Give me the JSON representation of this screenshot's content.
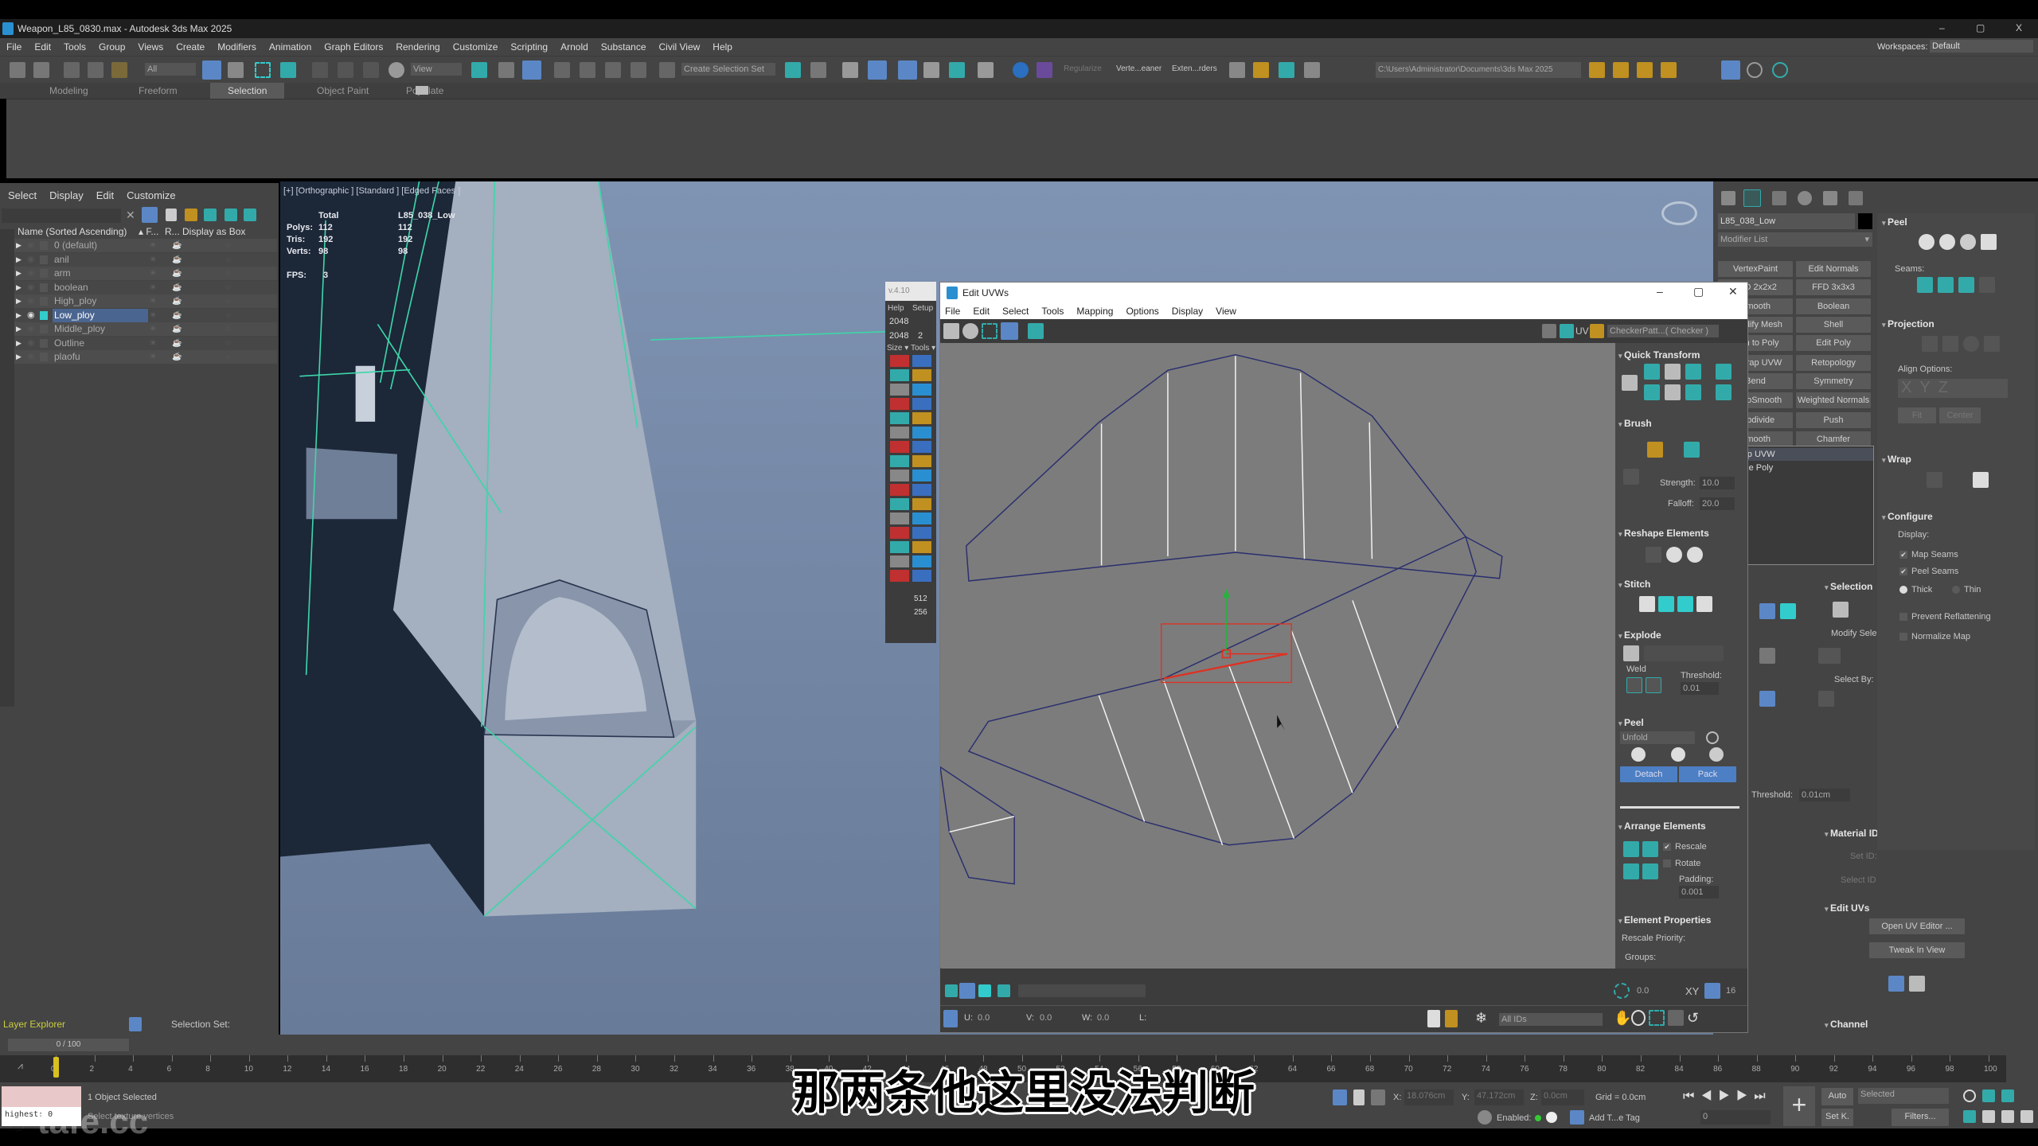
{
  "window": {
    "title": "Weapon_L85_0830.max - Autodesk 3ds Max 2025",
    "min": "–",
    "max": "▢",
    "close": "X",
    "workspaces_label": "Workspaces:",
    "workspace": "Default"
  },
  "menu": [
    "File",
    "Edit",
    "Tools",
    "Group",
    "Views",
    "Create",
    "Modifiers",
    "Animation",
    "Graph Editors",
    "Rendering",
    "Customize",
    "Scripting",
    "Arnold",
    "Substance",
    "Civil View",
    "Help"
  ],
  "toolbar": {
    "filter": "All",
    "ref_coord": "View",
    "selection_set": "Create Selection Set",
    "regularize": "Regularize",
    "vertex_cleaner": "Verte...eaner",
    "extenders": "Exten...rders",
    "project_path": "C:\\Users\\Administrator\\Documents\\3ds Max 2025"
  },
  "ribbon_tabs": [
    "Modeling",
    "Freeform",
    "Selection",
    "Object Paint",
    "Populate"
  ],
  "ribbon_active": "Selection",
  "scene_explorer": {
    "menu": [
      "Select",
      "Display",
      "Edit",
      "Customize"
    ],
    "columns": [
      "Name (Sorted Ascending)",
      "▴ F...",
      "R...",
      "Display as Box"
    ],
    "layers": [
      "0 (default)",
      "anil",
      "arm",
      "boolean",
      "High_ploy",
      "Low_ploy",
      "Middle_ploy",
      "Outline",
      "plaofu"
    ],
    "active": "Low_ploy",
    "footer": "Layer Explorer",
    "selection_set_label": "Selection Set:"
  },
  "viewport": {
    "label": "[+] [Orthographic ] [Standard ] [Edged Faces ]",
    "stats": {
      "col_total": "Total",
      "col_object": "L85_038_Low",
      "polys_label": "Polys:",
      "polys": "112",
      "polys_obj": "112",
      "tris_label": "Tris:",
      "tris": "192",
      "tris_obj": "192",
      "verts_label": "Verts:",
      "verts": "98",
      "verts_obj": "98",
      "fps_label": "FPS:",
      "fps": "3"
    }
  },
  "plugin_strip": {
    "version": "v.4.10",
    "help": "Help",
    "setup": "Setup",
    "w": "2048",
    "h": "2048",
    "n": "2",
    "size": "Size ▾",
    "tools": "Tools ▾",
    "v512": "512",
    "v256": "256"
  },
  "uvw": {
    "title": "Edit UVWs",
    "menu": [
      "File",
      "Edit",
      "Select",
      "Tools",
      "Mapping",
      "Options",
      "Display",
      "View"
    ],
    "texture": "CheckerPatt...( Checker )",
    "uv_label": "UV",
    "quick_transform": "Quick Transform",
    "brush": "Brush",
    "strength_label": "Strength:",
    "strength": "10.0",
    "falloff_label": "Falloff:",
    "falloff": "20.0",
    "reshape": "Reshape Elements",
    "stitch": "Stitch",
    "explode": "Explode",
    "weld": "Weld",
    "threshold_label": "Threshold:",
    "threshold": "0.01",
    "peel": "Peel",
    "unfold": "Unfold",
    "detach": "Detach",
    "pack": "Pack",
    "arrange": "Arrange Elements",
    "rescale": "Rescale",
    "rotate": "Rotate",
    "padding_label": "Padding:",
    "padding": "0.001",
    "element_props": "Element Properties",
    "rescale_priority": "Rescale Priority:",
    "groups": "Groups:",
    "bottom": {
      "spin1": "0.0",
      "spin2": "16",
      "xy": "XY",
      "u_label": "U:",
      "u": "0.0",
      "v_label": "V:",
      "v": "0.0",
      "w_label": "W:",
      "w": "0.0",
      "l_label": "L:",
      "ids": "All IDs"
    },
    "selected_color": "#e03020",
    "edge_color": "#2a2f6e"
  },
  "command_panel": {
    "object_name": "L85_038_Low",
    "modifier_list": "Modifier List",
    "buttons": [
      [
        "MeshSmooth",
        "VertexPaint",
        "Edit Normals"
      ],
      [
        "FFD 2x2x2",
        "FFD 3x3x3"
      ],
      [
        "Smooth",
        "Boolean"
      ],
      [
        "Quadify Mesh",
        "Shell"
      ],
      [
        "Turn to Poly",
        "Edit Poly"
      ],
      [
        "Unwrap UVW",
        "Retopology"
      ],
      [
        "Bend",
        "Symmetry"
      ],
      [
        "TurboSmooth",
        "Weighted Normals"
      ],
      [
        "Subdivide",
        "Push"
      ],
      [
        "Smooth",
        "Chamfer"
      ]
    ],
    "stack": [
      "Unwrap UVW",
      "Editable Poly"
    ],
    "selection": "Selection",
    "modify_selection": "Modify Selection:",
    "select_by": "Select By:",
    "sel_threshold_label": "Threshold:",
    "sel_threshold": "0.01cm",
    "material_ids": "Material IDs",
    "set_id": "Set ID:",
    "select_id": "Select ID",
    "edit_uvs": "Edit UVs",
    "open_uv_editor": "Open UV Editor ...",
    "tweak_in_view": "Tweak In View",
    "channel": "Channel",
    "peel": "Peel",
    "seams": "Seams:",
    "projection": "Projection",
    "align_options": "Align Options:",
    "fit": "Fit",
    "center": "Center",
    "wrap": "Wrap",
    "configure": "Configure",
    "display": "Display:",
    "map_seams": "Map Seams",
    "peel_seams": "Peel Seams",
    "thick": "Thick",
    "thin": "Thin",
    "prevent_reflattening": "Prevent Reflattening",
    "normalize_map": "Normalize Map",
    "map_seams_checked": true,
    "peel_seams_checked": true,
    "thick_selected": true
  },
  "timeline": {
    "frame": "0 / 100",
    "ticks": [
      0,
      2,
      4,
      6,
      8,
      10,
      12,
      14,
      16,
      18,
      20,
      22,
      24,
      26,
      28,
      30,
      32,
      34,
      36,
      38,
      40,
      42,
      44,
      46,
      48,
      50,
      52,
      54,
      56,
      58,
      60,
      62,
      64,
      66,
      68,
      70,
      72,
      74,
      76,
      78,
      80,
      82,
      84,
      86,
      88,
      90,
      92,
      94,
      96,
      98,
      100
    ],
    "current": 0
  },
  "status": {
    "selected": "1 Object Selected",
    "prompt": "Select texture vertices",
    "maxscript": "highest: 0",
    "x_label": "X:",
    "x": "18.076cm",
    "y_label": "Y:",
    "y": "47.172cm",
    "z_label": "Z:",
    "z": "0.0cm",
    "grid": "Grid = 0.0cm",
    "enabled": "Enabled:",
    "add_tag": "Add T...e Tag",
    "auto": "Auto",
    "set_key": "Set K.",
    "key_filter": "Selected",
    "filters": "Filters...",
    "frame": "0"
  },
  "subtitle": "那两条他这里没法判断",
  "watermark": "tafe.cc"
}
